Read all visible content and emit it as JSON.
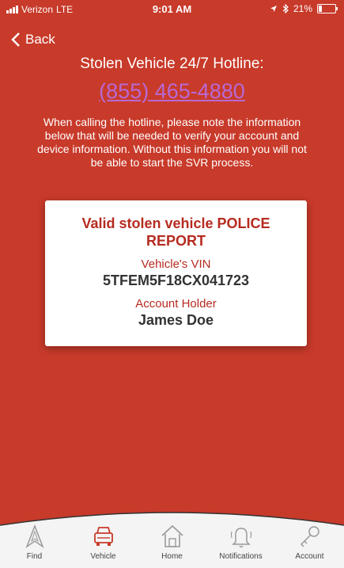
{
  "status": {
    "carrier": "Verizon",
    "network": "LTE",
    "time": "9:01 AM",
    "battery": "21%",
    "battery_level": 0.21
  },
  "nav": {
    "back_label": "Back"
  },
  "hotline": {
    "title": "Stolen Vehicle 24/7 Hotline:",
    "phone": "(855) 465-4880",
    "instructions": "When calling the hotline, please note the information below that will be needed to verify your account and device information. Without this information you will not be able to start the SVR process."
  },
  "card": {
    "title": "Valid stolen vehicle POLICE REPORT",
    "vin_label": "Vehicle's VIN",
    "vin_value": "5TFEM5F18CX041723",
    "holder_label": "Account Holder",
    "holder_value": "James Doe"
  },
  "tabs": [
    {
      "label": "Find",
      "icon": "find-icon",
      "active": false
    },
    {
      "label": "Vehicle",
      "icon": "car-icon",
      "active": true
    },
    {
      "label": "Home",
      "icon": "home-icon",
      "active": false
    },
    {
      "label": "Notifications",
      "icon": "bell-icon",
      "active": false
    },
    {
      "label": "Account",
      "icon": "key-icon",
      "active": false
    }
  ],
  "colors": {
    "background": "#c83a2a",
    "link": "#b869d3",
    "accent": "#b62b20",
    "tab_inactive": "#999999"
  }
}
